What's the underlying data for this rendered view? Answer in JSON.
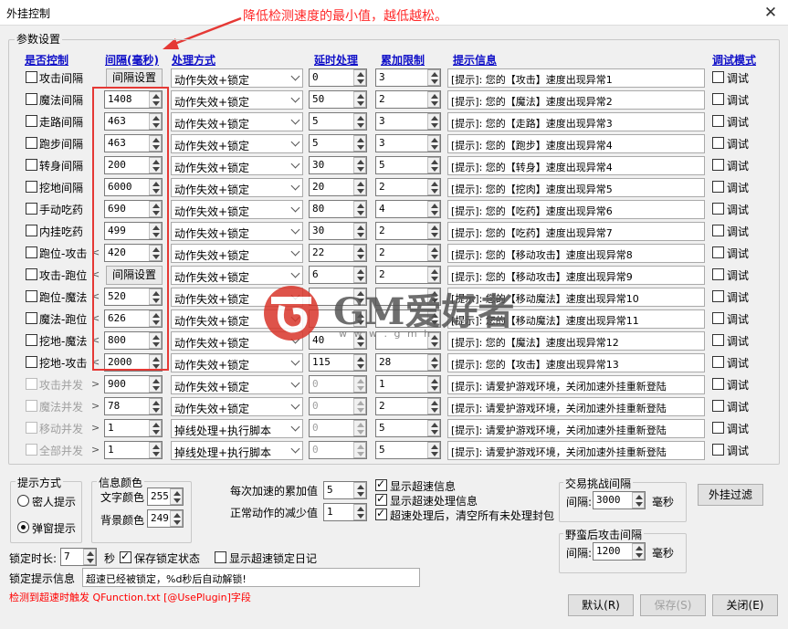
{
  "window": {
    "title": "外挂控制",
    "close": "✕"
  },
  "annotation": "降低检测速度的最小值，越低越松。",
  "params_group": "参数设置",
  "headers": {
    "enable": "是否控制",
    "interval": "间隔(毫秒)",
    "handle": "处理方式",
    "delay": "延时处理",
    "accum": "累加限制",
    "hint": "提示信息",
    "debug": "调试模式"
  },
  "interval_btn": "间隔设置",
  "debug_label": "调试",
  "rows": [
    {
      "name": "攻击间隔",
      "interval": "",
      "handle": "动作失效+锁定",
      "delay": "0",
      "limit": "3",
      "hint": "[提示]: 您的【攻击】速度出现异常1",
      "on": true,
      "arrow": ""
    },
    {
      "name": "魔法间隔",
      "interval": "1408",
      "handle": "动作失效+锁定",
      "delay": "50",
      "limit": "2",
      "hint": "[提示]: 您的【魔法】速度出现异常2",
      "on": true,
      "arrow": ""
    },
    {
      "name": "走路间隔",
      "interval": "463",
      "handle": "动作失效+锁定",
      "delay": "5",
      "limit": "3",
      "hint": "[提示]: 您的【走路】速度出现异常3",
      "on": true,
      "arrow": ""
    },
    {
      "name": "跑步间隔",
      "interval": "463",
      "handle": "动作失效+锁定",
      "delay": "5",
      "limit": "3",
      "hint": "[提示]: 您的【跑步】速度出现异常4",
      "on": true,
      "arrow": ""
    },
    {
      "name": "转身间隔",
      "interval": "200",
      "handle": "动作失效+锁定",
      "delay": "30",
      "limit": "5",
      "hint": "[提示]: 您的【转身】速度出现异常4",
      "on": true,
      "arrow": ""
    },
    {
      "name": "挖地间隔",
      "interval": "6000",
      "handle": "动作失效+锁定",
      "delay": "20",
      "limit": "2",
      "hint": "[提示]: 您的【挖肉】速度出现异常5",
      "on": true,
      "arrow": ""
    },
    {
      "name": "手动吃药",
      "interval": "690",
      "handle": "动作失效+锁定",
      "delay": "80",
      "limit": "4",
      "hint": "[提示]: 您的【吃药】速度出现异常6",
      "on": true,
      "arrow": ""
    },
    {
      "name": "内挂吃药",
      "interval": "499",
      "handle": "动作失效+锁定",
      "delay": "30",
      "limit": "2",
      "hint": "[提示]: 您的【吃药】速度出现异常7",
      "on": true,
      "arrow": ""
    },
    {
      "name": "跑位-攻击",
      "interval": "420",
      "handle": "动作失效+锁定",
      "delay": "22",
      "limit": "2",
      "hint": "[提示]: 您的【移动攻击】速度出现异常8",
      "on": true,
      "arrow": "<"
    },
    {
      "name": "攻击-跑位",
      "interval": "",
      "handle": "动作失效+锁定",
      "delay": "6",
      "limit": "2",
      "hint": "[提示]: 您的【移动攻击】速度出现异常9",
      "on": true,
      "arrow": "<"
    },
    {
      "name": "跑位-魔法",
      "interval": "520",
      "handle": "动作失效+锁定",
      "delay": "",
      "limit": "",
      "hint": "[提示]: 您的【移动魔法】速度出现异常10",
      "on": true,
      "arrow": "<"
    },
    {
      "name": "魔法-跑位",
      "interval": "626",
      "handle": "动作失效+锁定",
      "delay": "",
      "limit": "",
      "hint": "[提示]: 您的【移动魔法】速度出现异常11",
      "on": true,
      "arrow": "<"
    },
    {
      "name": "挖地-魔法",
      "interval": "800",
      "handle": "动作失效+锁定",
      "delay": "40",
      "limit": "",
      "hint": "[提示]: 您的【魔法】速度出现异常12",
      "on": true,
      "arrow": "<"
    },
    {
      "name": "挖地-攻击",
      "interval": "2000",
      "handle": "动作失效+锁定",
      "delay": "115",
      "limit": "28",
      "hint": "[提示]: 您的【攻击】速度出现异常13",
      "on": true,
      "arrow": "<"
    },
    {
      "name": "攻击并发",
      "interval": "900",
      "handle": "动作失效+锁定",
      "delay": "0",
      "limit": "1",
      "hint": "[提示]: 请爱护游戏环境，关闭加速外挂重新登陆",
      "on": false,
      "arrow": ">"
    },
    {
      "name": "魔法并发",
      "interval": "78",
      "handle": "动作失效+锁定",
      "delay": "0",
      "limit": "2",
      "hint": "[提示]: 请爱护游戏环境，关闭加速外挂重新登陆",
      "on": false,
      "arrow": ">"
    },
    {
      "name": "移动并发",
      "interval": "1",
      "handle": "掉线处理+执行脚本",
      "delay": "0",
      "limit": "5",
      "hint": "[提示]: 请爱护游戏环境，关闭加速外挂重新登陆",
      "on": false,
      "arrow": ">"
    },
    {
      "name": "全部并发",
      "interval": "1",
      "handle": "掉线处理+执行脚本",
      "delay": "0",
      "limit": "5",
      "hint": "[提示]: 请爱护游戏环境，关闭加速外挂重新登陆",
      "on": false,
      "arrow": ">"
    }
  ],
  "hint_mode": {
    "title": "提示方式",
    "secret": "密人提示",
    "popup": "弹窗提示"
  },
  "info_color": {
    "title": "信息颜色",
    "text_label": "文字颜色",
    "text_value": "255",
    "bg_label": "背景颜色",
    "bg_value": "249"
  },
  "accel": {
    "accum_label": "每次加速的累加值",
    "accum_value": "5",
    "reduce_label": "正常动作的减少值",
    "reduce_value": "1"
  },
  "options": {
    "show_info": "显示超速信息",
    "show_handle": "显示超速处理信息",
    "clear_after": "超速处理后，清空所有未处理封包"
  },
  "trade": {
    "title": "交易挑战间隔",
    "label": "间隔:",
    "value": "3000",
    "unit": "毫秒"
  },
  "savage": {
    "title": "野蛮后攻击间隔",
    "label": "间隔:",
    "value": "1200",
    "unit": "毫秒"
  },
  "plugin_filter": "外挂过滤",
  "lock": {
    "label": "锁定时长:",
    "value": "7",
    "unit": "秒",
    "save_state": "保存锁定状态",
    "show_log": "显示超速锁定日记"
  },
  "lock_msg": {
    "label": "锁定提示信息",
    "value": "超速已经被锁定，%d秒后自动解锁!"
  },
  "trigger_note": "检测到超速时触发 QFunction.txt [@UsePlugin]字段",
  "buttons": {
    "default": "默认(R)",
    "save": "保存(S)",
    "close": "关闭(E)"
  },
  "watermark": {
    "brand": "GM爱好者",
    "url": "w w w . g m h"
  }
}
